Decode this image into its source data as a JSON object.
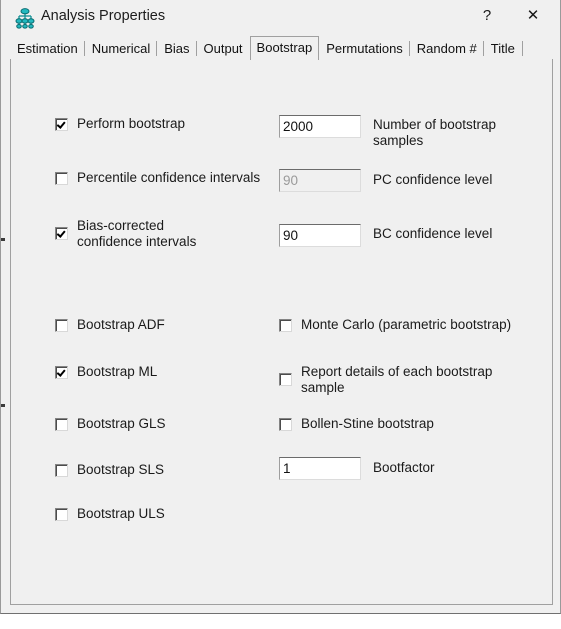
{
  "window": {
    "title": "Analysis Properties",
    "icon": "amos-tree-icon",
    "help_label": "?",
    "close_label": "✕",
    "accent": "#1a1a1a",
    "background": "#f0f0f0",
    "icon_color": "#17a3a8"
  },
  "tabs": [
    {
      "label": "Estimation",
      "active": false
    },
    {
      "label": "Numerical",
      "active": false
    },
    {
      "label": "Bias",
      "active": false
    },
    {
      "label": "Output",
      "active": false
    },
    {
      "label": "Bootstrap",
      "active": true
    },
    {
      "label": "Permutations",
      "active": false
    },
    {
      "label": "Random #",
      "active": false
    },
    {
      "label": "Title",
      "active": false
    }
  ],
  "bootstrap": {
    "perform_bootstrap": {
      "label": "Perform bootstrap",
      "checked": "true"
    },
    "num_samples": {
      "value": "2000",
      "label": "Number of bootstrap samples",
      "enabled": "true"
    },
    "percentile_ci": {
      "label": "Percentile confidence intervals",
      "checked": "false"
    },
    "pc_level": {
      "value": "90",
      "label": "PC confidence level",
      "enabled": "false"
    },
    "bias_corrected_ci": {
      "label": "Bias-corrected confidence intervals",
      "checked": "true"
    },
    "bc_level": {
      "value": "90",
      "label": "BC confidence level",
      "enabled": "true"
    },
    "bootstrap_adf": {
      "label": "Bootstrap ADF",
      "checked": "false"
    },
    "monte_carlo": {
      "label": "Monte Carlo (parametric bootstrap)",
      "checked": "false"
    },
    "bootstrap_ml": {
      "label": "Bootstrap ML",
      "checked": "true"
    },
    "report_details": {
      "label": "Report details of each bootstrap sample",
      "checked": "false"
    },
    "bootstrap_gls": {
      "label": "Bootstrap GLS",
      "checked": "false"
    },
    "bollen_stine": {
      "label": "Bollen-Stine bootstrap",
      "checked": "false"
    },
    "bootstrap_sls": {
      "label": "Bootstrap SLS",
      "checked": "false"
    },
    "bootfactor": {
      "value": "1",
      "label": "Bootfactor",
      "enabled": "true"
    },
    "bootstrap_uls": {
      "label": "Bootstrap ULS",
      "checked": "false"
    }
  }
}
